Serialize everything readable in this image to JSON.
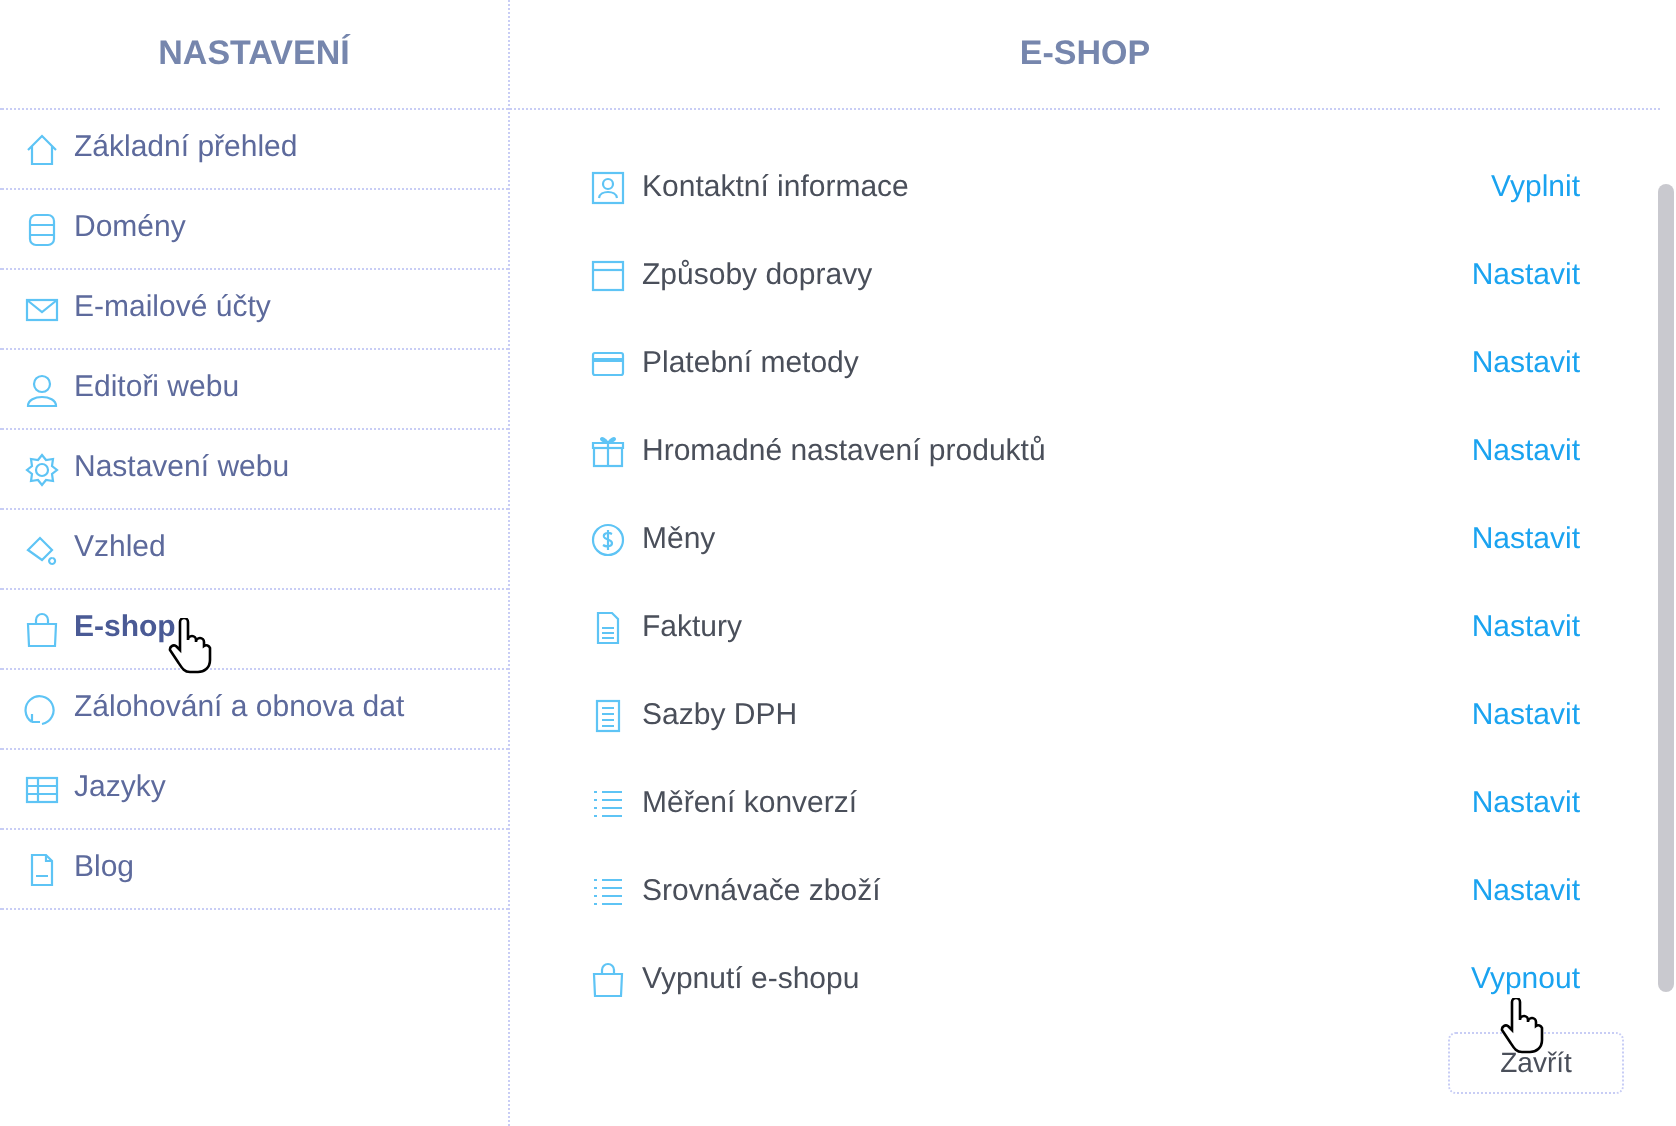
{
  "sidebar": {
    "title": "NASTAVENÍ",
    "items": [
      {
        "label": "Základní přehled",
        "selected": false
      },
      {
        "label": "Domény",
        "selected": false
      },
      {
        "label": "E-mailové účty",
        "selected": false
      },
      {
        "label": "Editoři webu",
        "selected": false
      },
      {
        "label": "Nastavení webu",
        "selected": false
      },
      {
        "label": "Vzhled",
        "selected": false
      },
      {
        "label": "E-shop",
        "selected": true
      },
      {
        "label": "Zálohování a obnova dat",
        "selected": false
      },
      {
        "label": "Jazyky",
        "selected": false
      },
      {
        "label": "Blog",
        "selected": false
      }
    ]
  },
  "panel": {
    "title": "E-SHOP",
    "rows": [
      {
        "label": "Kontaktní informace",
        "action": "Vyplnit"
      },
      {
        "label": "Způsoby dopravy",
        "action": "Nastavit"
      },
      {
        "label": "Platební metody",
        "action": "Nastavit"
      },
      {
        "label": "Hromadné nastavení produktů",
        "action": "Nastavit"
      },
      {
        "label": "Měny",
        "action": "Nastavit"
      },
      {
        "label": "Faktury",
        "action": "Nastavit"
      },
      {
        "label": "Sazby DPH",
        "action": "Nastavit"
      },
      {
        "label": "Měření konverzí",
        "action": "Nastavit"
      },
      {
        "label": "Srovnávače zboží",
        "action": "Nastavit"
      },
      {
        "label": "Vypnutí e-shopu",
        "action": "Vypnout"
      }
    ],
    "close_button": "Zavřít"
  }
}
